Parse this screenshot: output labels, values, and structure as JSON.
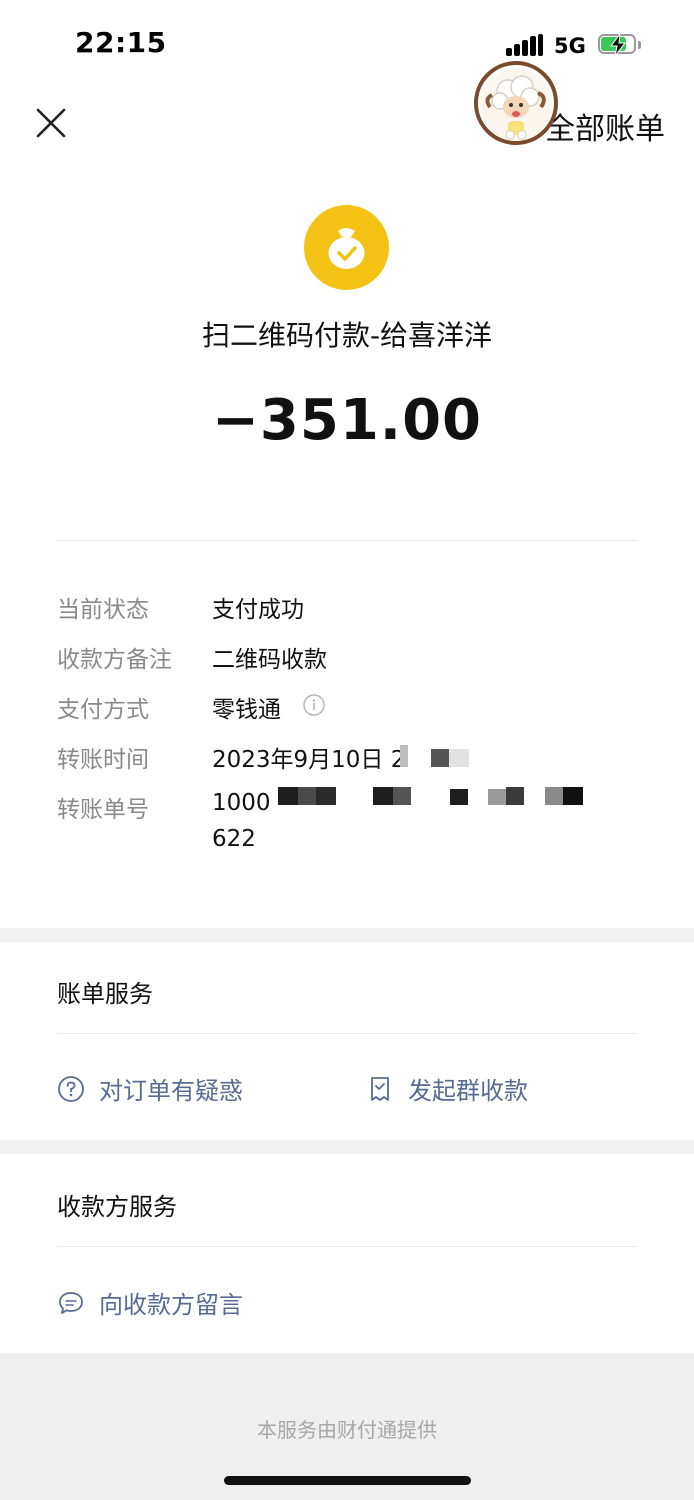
{
  "status_bar": {
    "time": "22:15",
    "network": "5G",
    "battery_level": 0.7,
    "battery_color": "#37c95a"
  },
  "nav": {
    "close_icon": "close-icon",
    "all_bills_label": "全部账单"
  },
  "transaction": {
    "icon": "money-bag-check-icon",
    "icon_color": "#f4c215",
    "title": "扫二维码付款-给喜洋洋",
    "amount": "−351.00"
  },
  "details": [
    {
      "label": "当前状态",
      "value": "支付成功"
    },
    {
      "label": "收款方备注",
      "value": "二维码收款"
    },
    {
      "label": "支付方式",
      "value": "零钱通"
    },
    {
      "label": "转账时间",
      "value": "2023年9月10日 2"
    },
    {
      "label": "转账单号",
      "value": "1000",
      "value_line2": "622"
    }
  ],
  "bill_services": {
    "title": "账单服务",
    "actions": [
      {
        "icon": "question-circle-icon",
        "label": "对订单有疑惑"
      },
      {
        "icon": "receipt-icon",
        "label": "发起群收款"
      }
    ]
  },
  "payee_services": {
    "title": "收款方服务",
    "actions": [
      {
        "icon": "chat-bubble-icon",
        "label": "向收款方留言"
      }
    ]
  },
  "footer": {
    "text": "本服务由财付通提供"
  },
  "colors": {
    "link": "#576b95",
    "label_gray": "#8a8a8a",
    "separator": "#f1f1f1"
  }
}
